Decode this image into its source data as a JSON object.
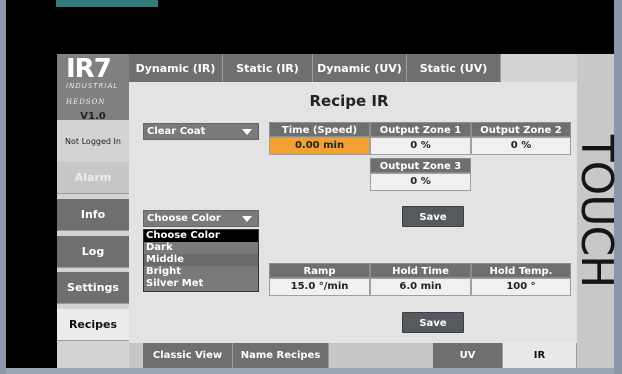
{
  "side_text": "TOUCH",
  "logo": {
    "brand": "IR7",
    "sub": "INDUSTRIAL",
    "company": "HEDSON"
  },
  "sidebar": {
    "version": "V1.0",
    "status": "Not Logged In",
    "items": [
      {
        "label": "Alarm",
        "state": "disabled"
      },
      {
        "label": "Info",
        "state": "normal"
      },
      {
        "label": "Log",
        "state": "normal"
      },
      {
        "label": "Settings",
        "state": "normal"
      },
      {
        "label": "Recipes",
        "state": "active"
      }
    ]
  },
  "tabs": [
    {
      "label": "Dynamic (IR)"
    },
    {
      "label": "Static (IR)"
    },
    {
      "label": "Dynamic (UV)"
    },
    {
      "label": "Static (UV)"
    }
  ],
  "title": "Recipe IR",
  "recipe_select": {
    "value": "Clear Coat"
  },
  "top_table": {
    "headers": {
      "time": "Time (Speed)",
      "zone1": "Output Zone 1",
      "zone2": "Output Zone 2",
      "zone3": "Output Zone 3"
    },
    "values": {
      "time": "0.00 min",
      "zone1": "0 %",
      "zone2": "0 %",
      "zone3": "0 %"
    }
  },
  "save_label": "Save",
  "color_select": {
    "value": "Choose Color",
    "options": [
      "Choose Color",
      "Dark",
      "Middle",
      "Bright",
      "Silver Met"
    ],
    "highlighted": "Middle"
  },
  "bottom_table": {
    "headers": {
      "ramp": "Ramp",
      "hold_time": "Hold Time",
      "hold_temp": "Hold Temp."
    },
    "values": {
      "ramp": "15.0 °/min",
      "hold_time": "6.0 min",
      "hold_temp": "100 °"
    }
  },
  "bottom_bar": [
    {
      "label": "Classic View"
    },
    {
      "label": "Name Recipes"
    },
    {
      "label": "UV"
    },
    {
      "label": "IR",
      "active": true
    }
  ],
  "colors": {
    "accent": "#f3a032",
    "button": "#6f6f6f",
    "panel": "#e3e3e3",
    "teal": "#2f7b7d"
  }
}
